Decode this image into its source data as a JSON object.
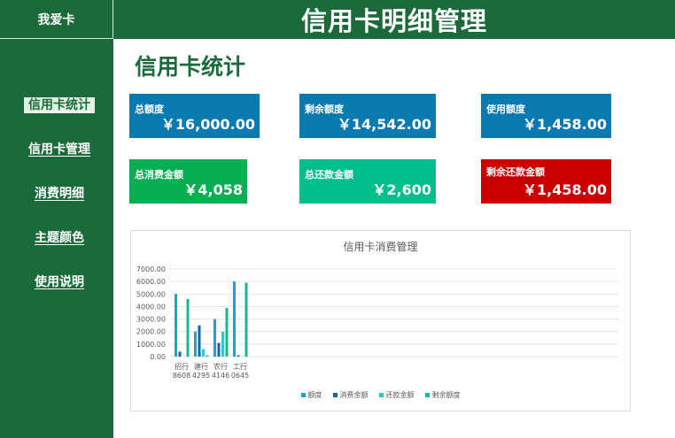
{
  "app": {
    "brand": "我爱卡",
    "title": "信用卡明细管理"
  },
  "nav": [
    {
      "label": "信用卡统计",
      "active": true
    },
    {
      "label": "信用卡管理",
      "active": false
    },
    {
      "label": "消费明细",
      "active": false
    },
    {
      "label": "主题颜色",
      "active": false
    },
    {
      "label": "使用说明",
      "active": false
    }
  ],
  "section_title": "信用卡统计",
  "cards": {
    "total_limit": {
      "label": "总额度",
      "value": "￥16,000.00"
    },
    "remaining_limit": {
      "label": "剩余额度",
      "value": "￥14,542.00"
    },
    "used_limit": {
      "label": "使用额度",
      "value": "￥1,458.00"
    },
    "total_spend": {
      "label": "总消费金额",
      "value": "￥4,058"
    },
    "total_repaid": {
      "label": "总还款金额",
      "value": "￥2,600"
    },
    "remaining_due": {
      "label": "剩余还款金额",
      "value": "￥1,458.00"
    }
  },
  "colors": {
    "brand_green": "#1b6b3a",
    "card_blue": "#0b7ab0",
    "card_green": "#06b050",
    "card_teal": "#00bf8c",
    "card_red": "#cc0000"
  },
  "chart_data": {
    "type": "bar",
    "title": "信用卡消费管理",
    "categories": [
      [
        "招行",
        "8608"
      ],
      [
        "建行",
        "4295"
      ],
      [
        "农行",
        "4146"
      ],
      [
        "工行",
        "0645"
      ]
    ],
    "series": [
      {
        "name": "额度",
        "color": "#1aa3d4",
        "values": [
          5000,
          2000,
          3000,
          6000
        ]
      },
      {
        "name": "消费金额",
        "color": "#0d6aa8",
        "values": [
          400,
          2500,
          1100,
          100
        ]
      },
      {
        "name": "还款金额",
        "color": "#33c6d6",
        "values": [
          0,
          600,
          2000,
          0
        ]
      },
      {
        "name": "剩余额度",
        "color": "#18b894",
        "values": [
          4600,
          100,
          3900,
          5900
        ]
      }
    ],
    "ylim": [
      0,
      7000
    ],
    "yticks": [
      "0.00",
      "1000.00",
      "2000.00",
      "3000.00",
      "4000.00",
      "5000.00",
      "6000.00",
      "7000.00"
    ],
    "grid": true,
    "legend_position": "bottom"
  }
}
